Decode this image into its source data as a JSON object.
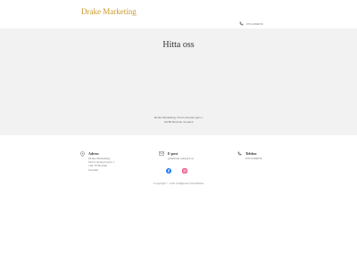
{
  "header": {
    "brand": "Drake Marketing",
    "phone": "070-0484656"
  },
  "hero": {
    "title": "Hitta oss",
    "address_line1": "Drake Marketing, Norra Avenyn gata 1",
    "address_line2": "16180 Borrisk, Sweden"
  },
  "footer": {
    "adress": {
      "title": "Adress",
      "lines": [
        "Drake Marketing,",
        "Norra Avenyn gata 1",
        "164 33 Borrisk",
        "Sweden"
      ]
    },
    "epost": {
      "title": "E-post",
      "value": "grundade.oska@1.se"
    },
    "telefon": {
      "title": "Telefon",
      "value": "070-0484656"
    },
    "social": [
      "facebook-icon",
      "instagram-icon"
    ],
    "copyright": "Copyright © Alla rättigheter förbehållna"
  },
  "colors": {
    "brand": "#c99a2e",
    "hero_bg": "#f2f2f2",
    "facebook": "#1877f2",
    "instagram": "#e1306c"
  }
}
